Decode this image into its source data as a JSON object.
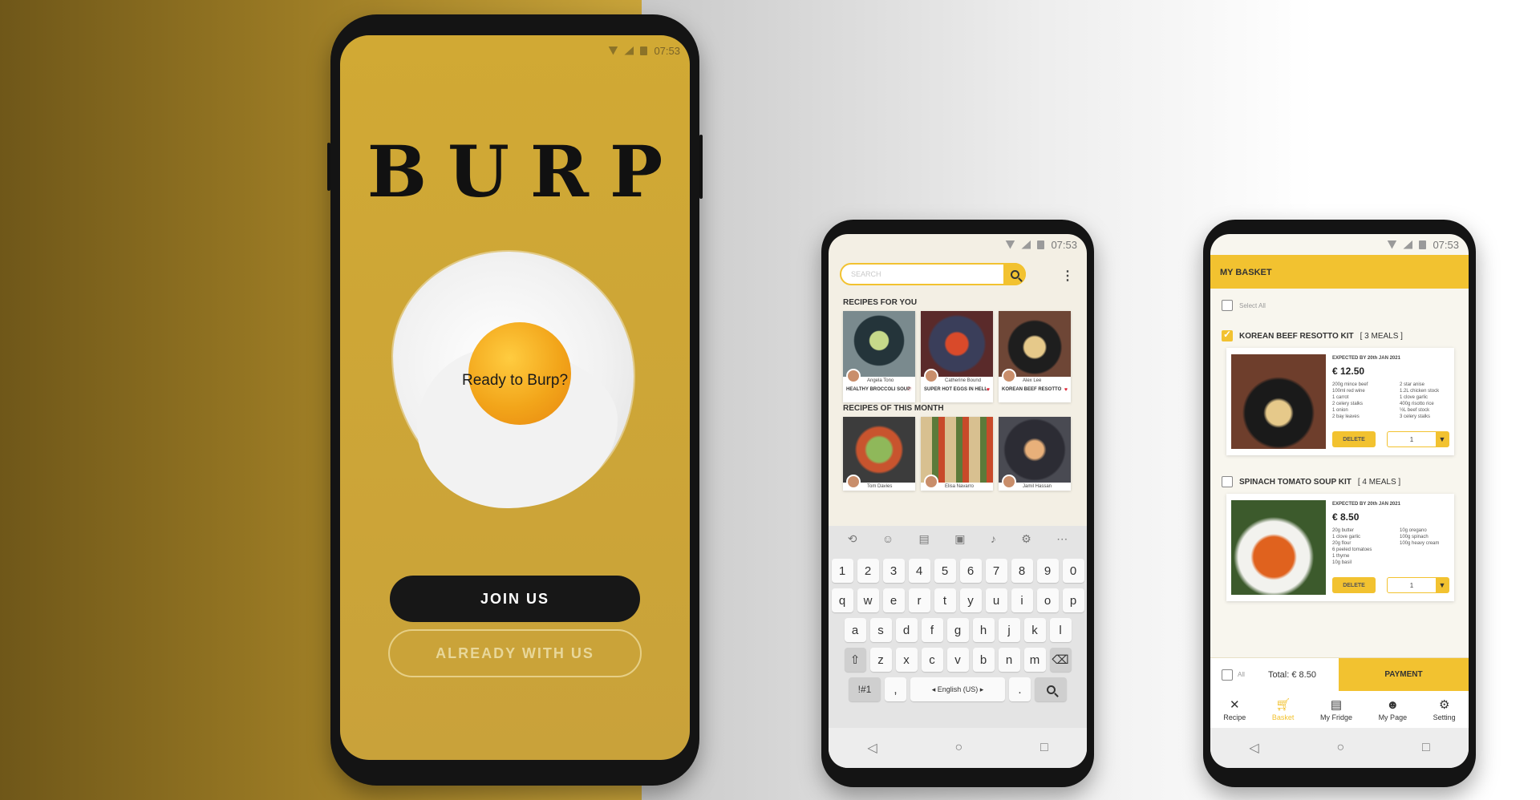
{
  "status_time": "07:53",
  "welcome": {
    "logo": "BURP",
    "tagline": "Ready to Burp?",
    "join_label": "JOIN US",
    "already_label": "ALREADY WITH US"
  },
  "browse": {
    "search_placeholder": "SEARCH",
    "section_for_you": "RECIPES FOR YOU",
    "section_month": "RECIPES OF THIS MONTH",
    "for_you": [
      {
        "author": "Angela Tono",
        "title": "HEALTHY BROCCOLI SOUP"
      },
      {
        "author": "Catherine Bound",
        "title": "SUPER HOT EGGS IN HELL"
      },
      {
        "author": "Alex Lee",
        "title": "KOREAN BEEF RESOTTO"
      }
    ],
    "this_month": [
      {
        "author": "Tom Davies"
      },
      {
        "author": "Elisa Navarro"
      },
      {
        "author": "Jamil Hassan"
      }
    ],
    "keyboard": {
      "numbers": [
        "1",
        "2",
        "3",
        "4",
        "5",
        "6",
        "7",
        "8",
        "9",
        "0"
      ],
      "row1": [
        "q",
        "w",
        "e",
        "r",
        "t",
        "y",
        "u",
        "i",
        "o",
        "p"
      ],
      "row2": [
        "a",
        "s",
        "d",
        "f",
        "g",
        "h",
        "j",
        "k",
        "l"
      ],
      "row3": [
        "z",
        "x",
        "c",
        "v",
        "b",
        "n",
        "m"
      ],
      "symbols_key": "!#1",
      "comma_key": ",",
      "space_label": "◂ English (US) ▸",
      "period_key": "."
    }
  },
  "basket": {
    "header": "MY BASKET",
    "select_all": "Select All",
    "kits": [
      {
        "name": "KOREAN BEEF RESOTTO KIT",
        "meals": "[ 3 MEALS ]",
        "expected": "EXPECTED BY 20th JAN 2021",
        "price": "€ 12.50",
        "ingredients_a": [
          "200g mince beef",
          "100ml red wine",
          "1 carrot",
          "2 celery stalks",
          "1 onion",
          "2 bay leaves"
        ],
        "ingredients_b": [
          "2 star anise",
          "1.2L chicken stock",
          "1 clove garlic",
          "400g risotto rice",
          "½L beef stock",
          "3 celery stalks"
        ],
        "delete_label": "DELETE",
        "qty": "1"
      },
      {
        "name": "SPINACH TOMATO SOUP KIT",
        "meals": "[ 4 MEALS ]",
        "expected": "EXPECTED BY 20th JAN 2021",
        "price": "€ 8.50",
        "ingredients_a": [
          "20g butter",
          "1 clove garlic",
          "20g flour",
          "6 peeled tomatoes",
          "1 thyme",
          "10g basil"
        ],
        "ingredients_b": [
          "10g oregano",
          "100g spinach",
          "100g heavy cream"
        ],
        "delete_label": "DELETE",
        "qty": "1"
      }
    ],
    "all_label": "All",
    "total": "Total: € 8.50",
    "payment_label": "PAYMENT",
    "tabs": [
      {
        "label": "Recipe",
        "icon": "utensils-icon"
      },
      {
        "label": "Basket",
        "icon": "cart-icon"
      },
      {
        "label": "My Fridge",
        "icon": "fridge-icon"
      },
      {
        "label": "My Page",
        "icon": "face-icon"
      },
      {
        "label": "Setting",
        "icon": "gear-icon"
      }
    ]
  },
  "colors": {
    "accent_yellow": "#f2c230",
    "welcome_bg": "#d1a934",
    "dark": "#171717"
  }
}
